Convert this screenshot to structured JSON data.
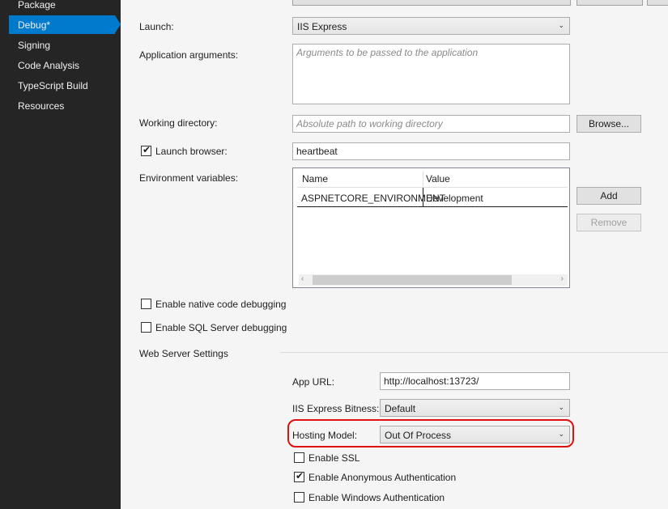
{
  "sidebar": {
    "items": [
      {
        "label": "Package"
      },
      {
        "label": "Debug*"
      },
      {
        "label": "Signing"
      },
      {
        "label": "Code Analysis"
      },
      {
        "label": "TypeScript Build"
      },
      {
        "label": "Resources"
      }
    ],
    "selected": "Debug*"
  },
  "form": {
    "launch_label": "Launch:",
    "launch_value": "IIS Express",
    "app_args_label": "Application arguments:",
    "app_args_placeholder": "Arguments to be passed to the application",
    "working_dir_label": "Working directory:",
    "working_dir_placeholder": "Absolute path to working directory",
    "browse_label": "Browse...",
    "launch_browser_label": "Launch browser:",
    "launch_browser_checked": true,
    "launch_browser_value": "heartbeat",
    "env_vars_label": "Environment variables:",
    "env_grid": {
      "columns": [
        "Name",
        "Value"
      ],
      "rows": [
        [
          "ASPNETCORE_ENVIRONMENT",
          "Development"
        ]
      ]
    },
    "add_label": "Add",
    "remove_label": "Remove",
    "native_debug_label": "Enable native code debugging",
    "sql_debug_label": "Enable SQL Server debugging"
  },
  "web_server": {
    "section_title": "Web Server Settings",
    "app_url_label": "App URL:",
    "app_url_value": "http://localhost:13723/",
    "bitness_label": "IIS Express Bitness:",
    "bitness_value": "Default",
    "hosting_label": "Hosting Model:",
    "hosting_value": "Out Of Process",
    "ssl_label": "Enable SSL",
    "anon_auth_label": "Enable Anonymous Authentication",
    "windows_auth_label": "Enable Windows Authentication"
  },
  "colors": {
    "sidebar_bg": "#252526",
    "selection": "#007acc",
    "highlight": "#e01010"
  }
}
